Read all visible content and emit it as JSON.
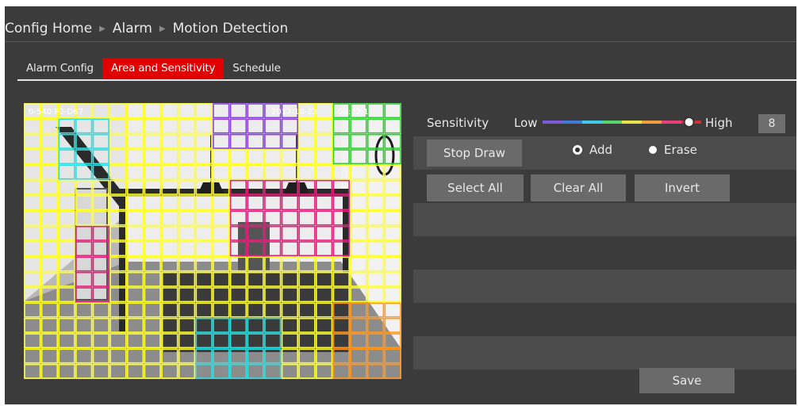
{
  "breadcrumb": {
    "home": "Config Home",
    "alarm": "Alarm",
    "page": "Motion Detection"
  },
  "tabs": [
    {
      "label": "Alarm Config"
    },
    {
      "label": "Area and Sensitivity"
    },
    {
      "label": "Schedule"
    }
  ],
  "tab_active": "Area and Sensitivity",
  "preview": {
    "osd_left": "0-540-P2-D67",
    "osd_date": "2017-10-23",
    "osd_time": "09:23:1",
    "grid_color": "#ffff33"
  },
  "sensitivity": {
    "label": "Sensitivity",
    "low": "Low",
    "high": "High",
    "value": "8",
    "level_fraction": 0.95
  },
  "buttons": {
    "stop_draw": "Stop Draw",
    "select_all": "Select All",
    "clear_all": "Clear All",
    "invert": "Invert",
    "save": "Save"
  },
  "draw_mode": {
    "add": "Add",
    "erase": "Erase",
    "selected": "Add"
  },
  "colors": {
    "accent": "#e00000",
    "grid": "#ffff33",
    "region_cyan": "#33dddd",
    "region_purple": "#8844dd",
    "region_green": "#33cc33",
    "region_pink": "#dd2277",
    "region_orange": "#ff9922"
  }
}
